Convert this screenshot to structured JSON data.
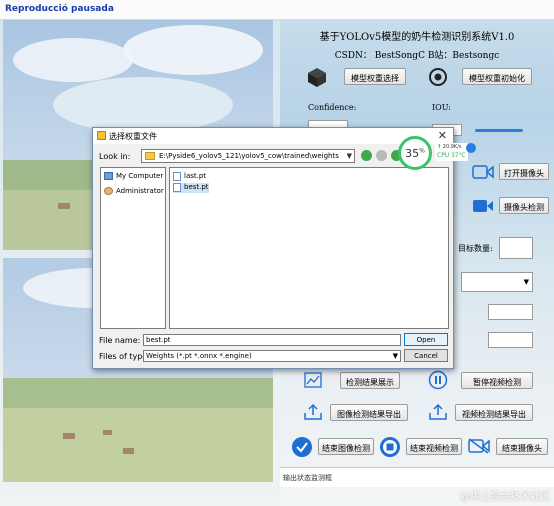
{
  "window": {
    "title": "Reproducció pausada"
  },
  "right_panel": {
    "heading": "基于YOLOv5模型的奶牛检测识别系统V1.0",
    "subheading": "CSDN： BestSongC   B站：Bestsongc",
    "buttons": {
      "model_select": "模型权重选择",
      "model_init": "模型权重初始化",
      "open_camera": "打开摄像头",
      "camera_detect": "摄像头检测",
      "show_results": "检测结果展示",
      "pause_video": "暂停视频检测",
      "export_image_results": "图像检测结果导出",
      "export_video_results": "视频检测结果导出",
      "end_image_detect": "结束图像检测",
      "end_video_detect": "结束视频检测",
      "end_camera": "结束摄像头"
    },
    "labels": {
      "confidence": "Confidence:",
      "iou": "IOU:",
      "target_count": "目标数量:",
      "status_placeholder": "输出状态监测框"
    }
  },
  "dialog": {
    "title": "选择权重文件",
    "look_in_label": "Look in:",
    "path": "E:\\Pyside6_yolov5_121\\yolov5_cow\\trained\\weights",
    "sidebar": [
      {
        "label": "My Computer",
        "icon": "computer-icon"
      },
      {
        "label": "Administrator",
        "icon": "user-icon"
      }
    ],
    "files": [
      {
        "name": "last.pt",
        "selected": false
      },
      {
        "name": "best.pt",
        "selected": true
      }
    ],
    "file_name_label": "File name:",
    "file_name_value": "best.pt",
    "file_type_label": "Files of type:",
    "file_type_value": "Weights (*.pt *.onnx *.engine)",
    "open_label": "Open",
    "cancel_label": "Cancel",
    "close_glyph": "✕"
  },
  "cpu_widget": {
    "percent": "35",
    "percent_unit": "%",
    "net_speed": "↑ 20.9K/s",
    "cpu_text": "CPU 37℃"
  },
  "watermark": "@稀土掘金技术社区",
  "colors": {
    "accent": "#2a7de1",
    "cpu_ring": "#37c46a",
    "selection": "#cce4f7"
  }
}
